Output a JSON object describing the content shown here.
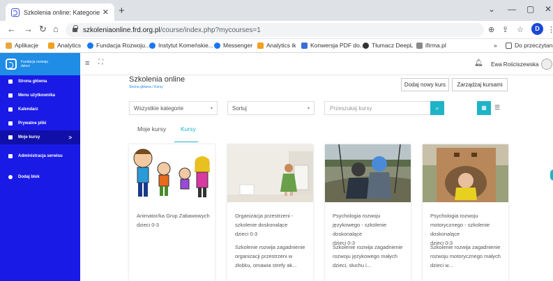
{
  "browser": {
    "tab_title": "Szkolenia online: Kategorie kurs",
    "new_tab": "+",
    "url_host": "szkoleniaonline.frd.org.pl",
    "url_path": "/course/index.php?mycourses=1",
    "profile_initial": "D",
    "bookmarks": [
      "Aplikacje",
      "Analytics",
      "Fundacja Rozwoju...",
      "Instytut Komeńskie...",
      "Messenger",
      "Analytics ik",
      "Konwersja PDF do...",
      "Tłumacz DeepL",
      "ifirma.pl"
    ],
    "bookmarks_more": "»",
    "reading_list": "Do przeczytania"
  },
  "sidebar": {
    "logo_text": "Fundacja rozwoju dzieci",
    "items": [
      {
        "label": "Strona główna",
        "active": false
      },
      {
        "label": "Menu użytkownika",
        "active": false
      },
      {
        "label": "Kalendarz",
        "active": false
      },
      {
        "label": "Prywatne pliki",
        "active": false
      },
      {
        "label": "Moje kursy",
        "active": true,
        "chevron": ">"
      },
      {
        "label": "Administracja serwisu",
        "active": false
      },
      {
        "label": "Dodaj blok",
        "active": false
      }
    ]
  },
  "topbar": {
    "username": "Ewa Rościszewska"
  },
  "page": {
    "title": "Szkolenia online",
    "breadcrumb": "Strona główna  /  Kursy",
    "add_course": "Dodaj nowy kurs",
    "manage_courses": "Zarządzaj kursami",
    "category_select": "Wszystkie kategorie",
    "sort_select": "Sortuj",
    "search_placeholder": "Przeszukaj kursy",
    "tabs": [
      "Moje kursy",
      "Kursy"
    ],
    "active_tab": "Kursy"
  },
  "courses": [
    {
      "title": "Animator/ka Grup Zabawowych",
      "age": "dzieci 0-3",
      "desc": ""
    },
    {
      "title": "Organizacja przestrzeni - szkolenie doskonalące",
      "age": "dzieci 0-3",
      "desc": "Szkolenie rozwija zagadnienie organizacji przestrzeni w żłobku, omawia strefy ak..."
    },
    {
      "title": "Psychologia rozwoju językowego - szkolenie doskonalące",
      "age": "dzieci 0-3",
      "desc": "Szkolenie rozwija zagadnienie rozwoju językowego małych dzieci, słuchu i..."
    },
    {
      "title": "Psychologia rozwoju motorycznego - szkolenie doskonalące",
      "age": "dzieci 0-3",
      "desc": "Szkolenie rozwija zagadnienie rozwoju motorycznego małych dzieci w..."
    }
  ],
  "colors": {
    "sidebar": "#1a1ae6",
    "logo_bg": "#1f8ce6",
    "accent": "#1fb3c6"
  }
}
